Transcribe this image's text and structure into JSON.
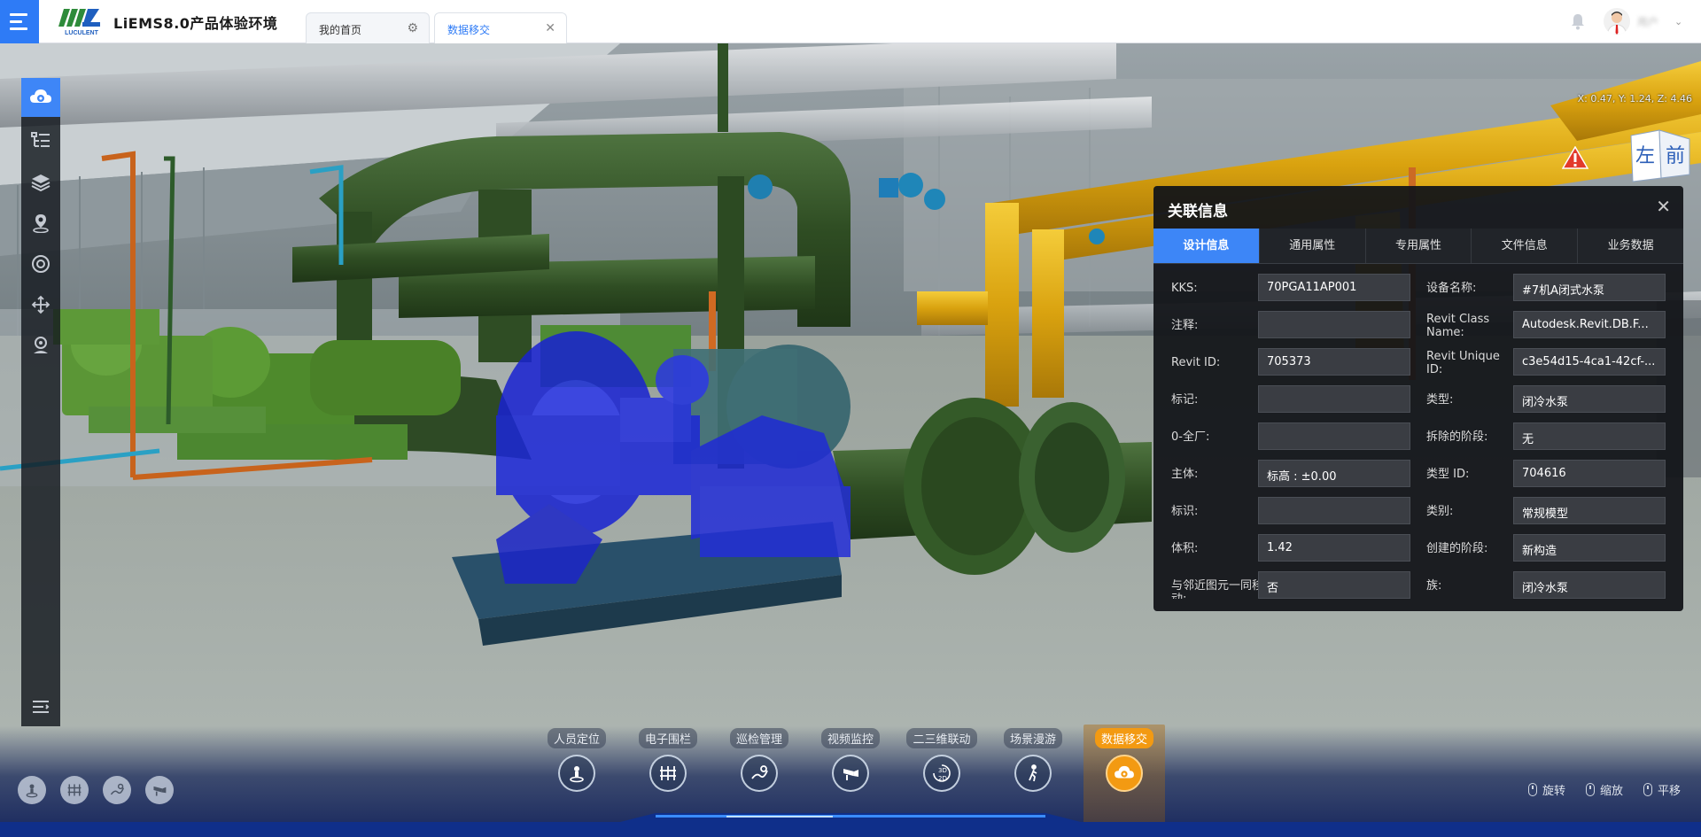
{
  "header": {
    "app_title": "LiEMS8.0产品体验环境",
    "logo_text": "LUCULENT",
    "tabs": [
      {
        "label": "我的首页",
        "icon": "gear-icon"
      },
      {
        "label": "数据移交",
        "icon": "close-icon"
      }
    ],
    "username": "用户"
  },
  "viewer": {
    "coords": "X: 0.47, Y: 1.24, Z: 4.46",
    "viewcube_faces": [
      "左",
      "前"
    ]
  },
  "left_toolbar": {
    "items": [
      {
        "icon": "cloud-data-icon",
        "active": true
      },
      {
        "icon": "tree-list-icon"
      },
      {
        "icon": "layers-icon"
      },
      {
        "icon": "location-pin-icon"
      },
      {
        "icon": "target-icon"
      },
      {
        "icon": "move-arrows-icon"
      },
      {
        "icon": "map-marker-icon"
      },
      {
        "icon": "collapse-menu-icon"
      }
    ]
  },
  "panel": {
    "title": "关联信息",
    "tabs": [
      "设计信息",
      "通用属性",
      "专用属性",
      "文件信息",
      "业务数据"
    ],
    "rows": [
      {
        "l1": "KKS:",
        "v1": "70PGA11AP001",
        "l2": "设备名称:",
        "v2": "#7机A闭式水泵"
      },
      {
        "l1": "注释:",
        "v1": "",
        "l2": "Revit Class Name:",
        "v2": "Autodesk.Revit.DB.F..."
      },
      {
        "l1": "Revit ID:",
        "v1": "705373",
        "l2": "Revit Unique ID:",
        "v2": "c3e54d15-4ca1-42cf-..."
      },
      {
        "l1": "标记:",
        "v1": "",
        "l2": "类型:",
        "v2": "闭冷水泵"
      },
      {
        "l1": "0-全厂:",
        "v1": "",
        "l2": "拆除的阶段:",
        "v2": "无"
      },
      {
        "l1": "主体:",
        "v1": "标高 : ±0.00",
        "l2": "类型 ID:",
        "v2": "704616"
      },
      {
        "l1": "标识:",
        "v1": "",
        "l2": "类别:",
        "v2": "常规模型"
      },
      {
        "l1": "体积:",
        "v1": "1.42",
        "l2": "创建的阶段:",
        "v2": "新构造"
      },
      {
        "l1": "与邻近图元一同移动:",
        "v1": "否",
        "l2": "族:",
        "v2": "闭冷水泵"
      }
    ]
  },
  "modules": [
    {
      "label": "人员定位",
      "icon": "person-locate-icon"
    },
    {
      "label": "电子围栏",
      "icon": "fence-icon"
    },
    {
      "label": "巡检管理",
      "icon": "inspection-icon"
    },
    {
      "label": "视频监控",
      "icon": "camera-icon"
    },
    {
      "label": "二三维联动",
      "icon": "2d3d-icon"
    },
    {
      "label": "场景漫游",
      "icon": "walk-icon"
    },
    {
      "label": "数据移交",
      "icon": "cloud-data-icon",
      "active": true
    }
  ],
  "quick_tools": [
    "person-locate-icon",
    "fence-icon",
    "inspection-icon",
    "camera-icon"
  ],
  "mouse_hints": [
    "旋转",
    "缩放",
    "平移"
  ],
  "colors": {
    "accent_blue": "#3d86f7",
    "active_orange": "#f39a12",
    "pipe_green": "#3b5a2b",
    "pipe_yellow": "#e2ad13",
    "pump_blue": "#1f28d8"
  }
}
